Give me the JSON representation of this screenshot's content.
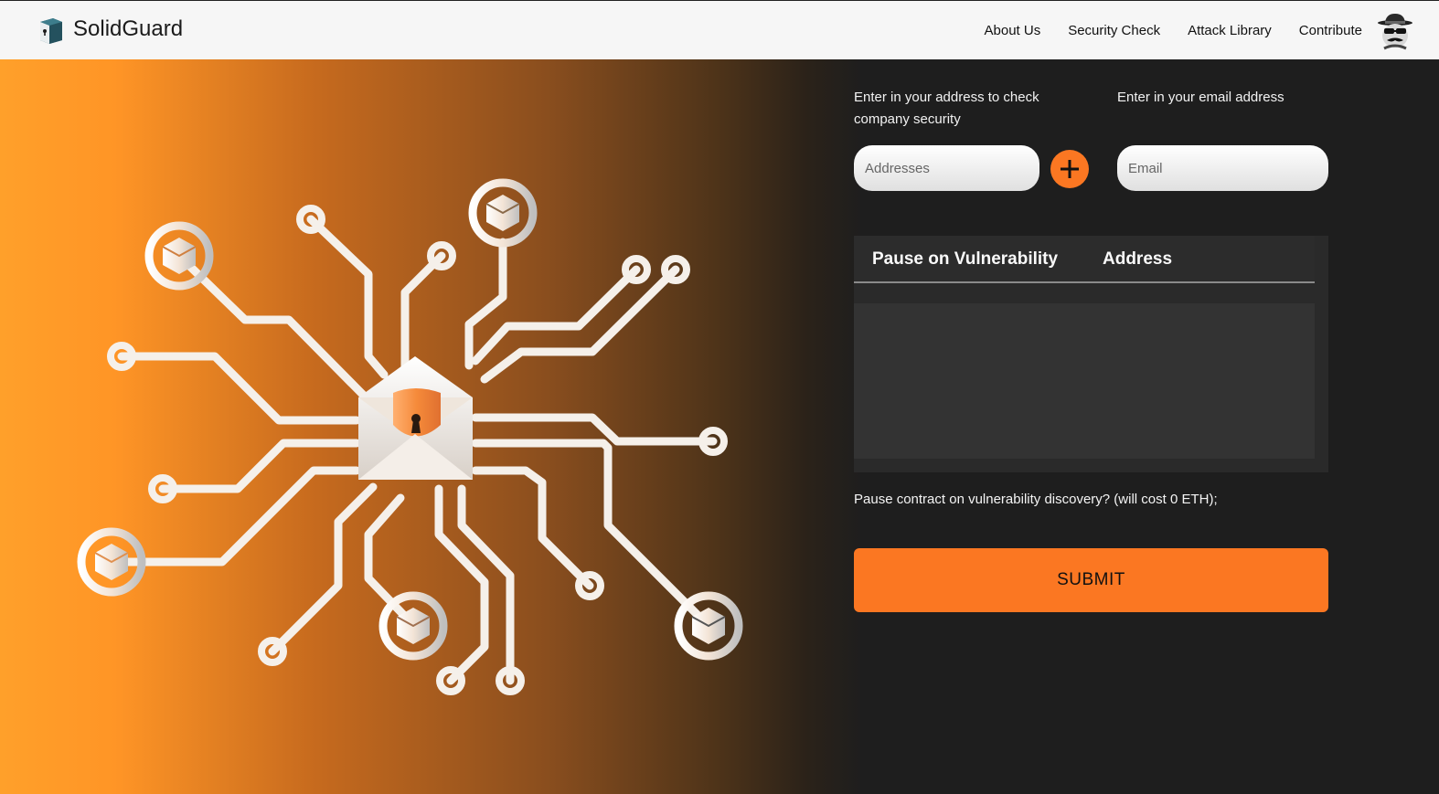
{
  "brand": {
    "name": "SolidGuard",
    "logo_icon": "lock-box-icon"
  },
  "nav": {
    "items": [
      {
        "label": "About Us"
      },
      {
        "label": "Security Check"
      },
      {
        "label": "Attack Library"
      },
      {
        "label": "Contribute"
      }
    ],
    "avatar_icon": "spy-avatar-icon"
  },
  "form": {
    "address_label": "Enter in your address to check company security",
    "address_placeholder": "Addresses",
    "add_button_icon": "plus-icon",
    "email_label": "Enter in your email address",
    "email_placeholder": "Email",
    "table": {
      "columns": [
        "Pause on Vulnerability",
        "Address"
      ],
      "rows": []
    },
    "pause_text": "Pause contract on vulnerability discovery? (will cost 0 ETH);",
    "submit_label": "SUBMIT"
  },
  "colors": {
    "accent": "#fb7722",
    "navbar_bg": "#f6f6f6",
    "page_bg": "#1e1e1e",
    "gradient_start": "#ffa02a"
  },
  "illustration": {
    "icon": "network-envelope-shield-icon"
  }
}
